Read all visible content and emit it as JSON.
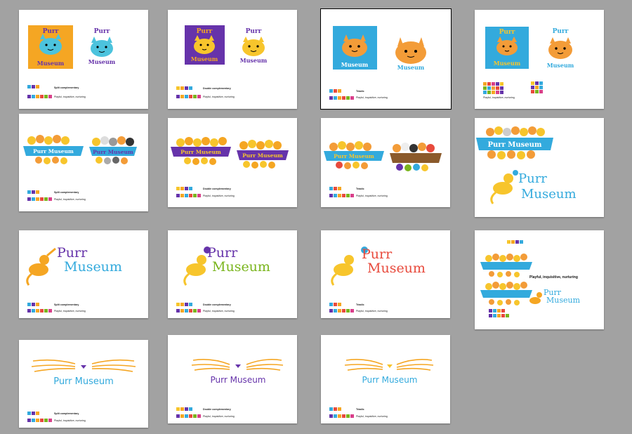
{
  "brand": {
    "name": "Purr Museum",
    "word1": "Purr",
    "word2": "Museum",
    "tagline": "Playful, inquisitive, nurturing"
  },
  "schemes": {
    "split": "Split complementary",
    "double": "Double complementary",
    "triadic": "Triadic"
  },
  "colors": {
    "canvas": "#a2a2a2",
    "blue": "#33aadd",
    "purple": "#6633aa",
    "orange": "#f5a623",
    "cat_yellow": "#f7c52c",
    "cat_orange": "#f39c38",
    "teal_cat": "#4cc3dd",
    "red": "#e84a3c",
    "green": "#7ab51d",
    "pink": "#d93f8a"
  },
  "slides": [
    {
      "id": 1,
      "kind": "badge",
      "scheme": "split",
      "selected": false
    },
    {
      "id": 2,
      "kind": "badge",
      "scheme": "double",
      "selected": false
    },
    {
      "id": 3,
      "kind": "badge",
      "scheme": "triadic",
      "selected": true
    },
    {
      "id": 4,
      "kind": "badge",
      "scheme": "none",
      "selected": false
    },
    {
      "id": 5,
      "kind": "banner",
      "scheme": "split",
      "selected": false
    },
    {
      "id": 6,
      "kind": "banner",
      "scheme": "double",
      "selected": false
    },
    {
      "id": 7,
      "kind": "banner",
      "scheme": "triadic",
      "selected": false
    },
    {
      "id": 8,
      "kind": "banner-wordmark",
      "scheme": "none",
      "selected": false
    },
    {
      "id": 9,
      "kind": "wordmark",
      "scheme": "split",
      "selected": false
    },
    {
      "id": 10,
      "kind": "wordmark",
      "scheme": "double",
      "selected": false
    },
    {
      "id": 11,
      "kind": "wordmark",
      "scheme": "triadic",
      "selected": false
    },
    {
      "id": 12,
      "kind": "combined",
      "scheme": "none",
      "selected": false
    },
    {
      "id": 13,
      "kind": "whiskers",
      "scheme": "split",
      "selected": false
    },
    {
      "id": 14,
      "kind": "whiskers",
      "scheme": "double",
      "selected": false
    },
    {
      "id": 15,
      "kind": "whiskers",
      "scheme": "triadic",
      "selected": false
    }
  ]
}
